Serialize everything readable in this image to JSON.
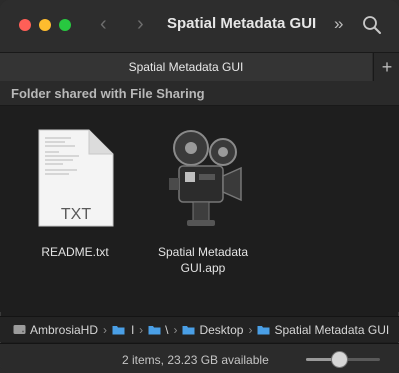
{
  "window": {
    "title": "Spatial Metadata GUI"
  },
  "toolbar": {
    "back_icon": "chevron-left-icon",
    "forward_icon": "chevron-right-icon",
    "more_icon": "double-chevron-icon",
    "search_icon": "search-icon"
  },
  "tabs": [
    {
      "label": "Spatial Metadata GUI"
    }
  ],
  "tab_add_label": "+",
  "shared_header": "Folder shared with File Sharing",
  "files": [
    {
      "name": "README.txt",
      "icon": "txt-document-icon",
      "badge": "TXT"
    },
    {
      "name": "Spatial Metadata GUI.app",
      "icon": "movie-camera-app-icon"
    }
  ],
  "breadcrumb": [
    {
      "label": "AmbrosiaHD",
      "icon": "hard-drive-icon"
    },
    {
      "label": " l",
      "icon": "folder-icon"
    },
    {
      "label": "\\",
      "icon": "folder-icon"
    },
    {
      "label": "Desktop",
      "icon": "folder-icon"
    },
    {
      "label": "Spatial Metadata GUI",
      "icon": "folder-icon"
    }
  ],
  "breadcrumb_separator": "›",
  "status": {
    "text": "2 items, 23.23 GB available",
    "icon_size_level": 0.45
  },
  "colors": {
    "close": "#ff5f57",
    "minimize": "#febc2e",
    "maximize": "#28c840",
    "folder_blue": "#4a9fe6"
  }
}
